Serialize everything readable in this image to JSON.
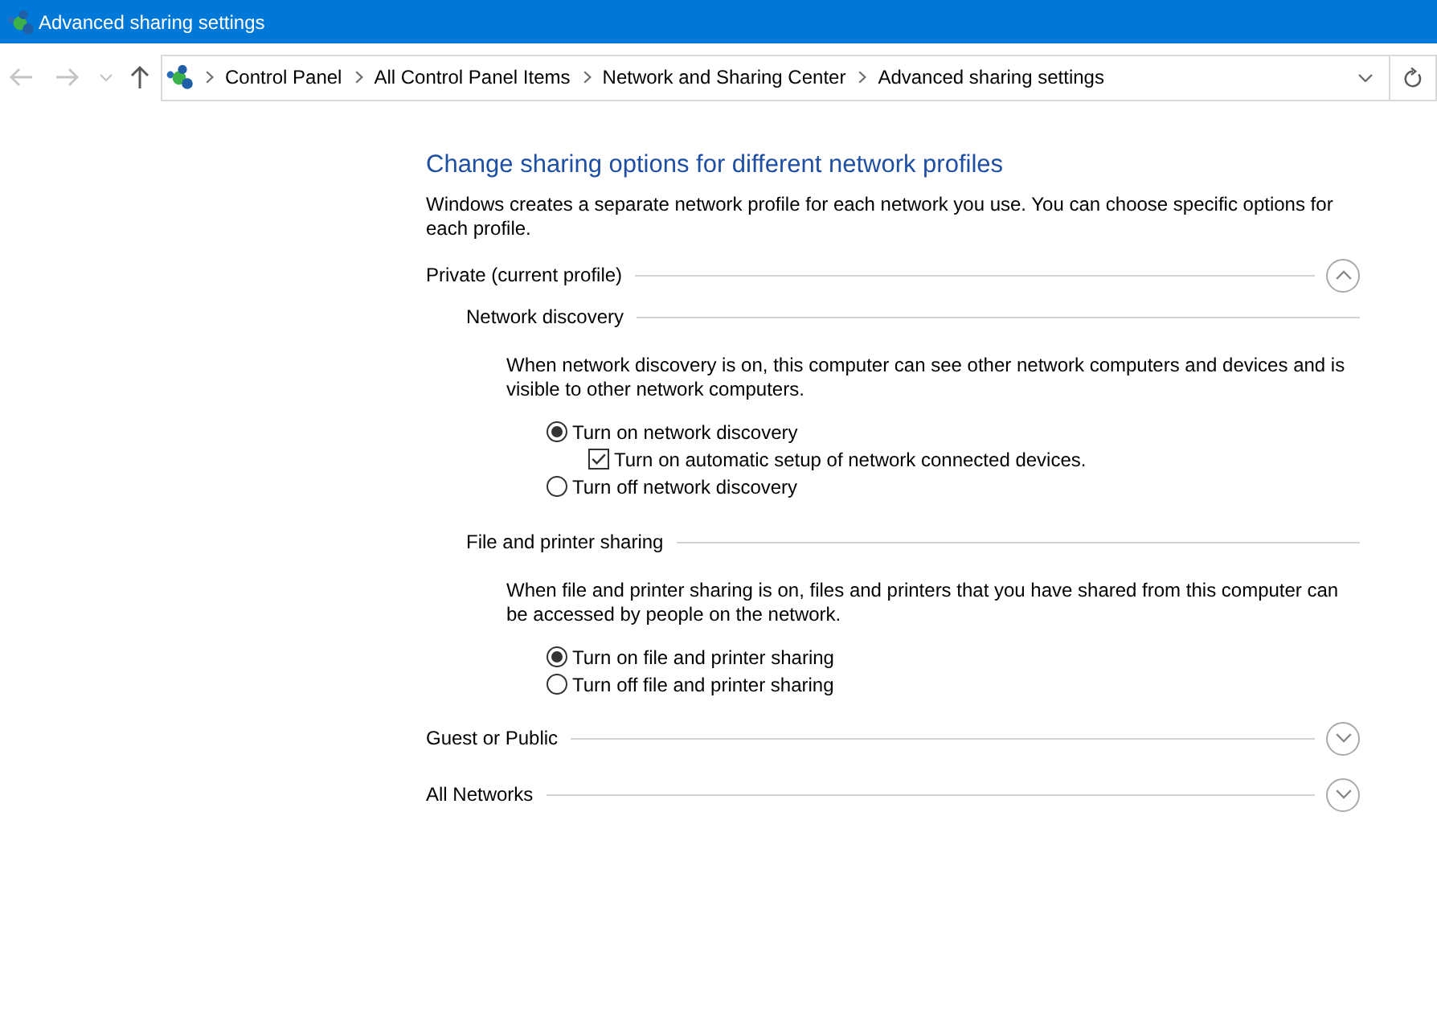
{
  "window": {
    "title": "Advanced sharing settings"
  },
  "nav_buttons": [
    {
      "kind": "back",
      "disabled": true
    },
    {
      "kind": "forward",
      "disabled": true
    },
    {
      "kind": "recent",
      "disabled": true
    },
    {
      "kind": "up",
      "disabled": false
    }
  ],
  "address_bar": {
    "breadcrumbs": [
      "Control Panel",
      "All Control Panel Items",
      "Network and Sharing Center",
      "Advanced sharing settings"
    ]
  },
  "page": {
    "heading": "Change sharing options for different network profiles",
    "description": "Windows creates a separate network profile for each network you use. You can choose specific options for each profile."
  },
  "profiles": [
    {
      "name": "Private (current profile)",
      "expanded": true,
      "sections": [
        {
          "title": "Network discovery",
          "description": "When network discovery is on, this computer can see other network computers and devices and is visible to other network computers.",
          "options": [
            {
              "kind": "radio",
              "label": "Turn on network discovery",
              "selected": true,
              "children": [
                {
                  "kind": "checkbox",
                  "label": "Turn on automatic setup of network connected devices.",
                  "checked": true
                }
              ]
            },
            {
              "kind": "radio",
              "label": "Turn off network discovery",
              "selected": false
            }
          ]
        },
        {
          "title": "File and printer sharing",
          "description": "When file and printer sharing is on, files and printers that you have shared from this computer can be accessed by people on the network.",
          "options": [
            {
              "kind": "radio",
              "label": "Turn on file and printer sharing",
              "selected": true
            },
            {
              "kind": "radio",
              "label": "Turn off file and printer sharing",
              "selected": false
            }
          ]
        }
      ]
    },
    {
      "name": "Guest or Public",
      "expanded": false
    },
    {
      "name": "All Networks",
      "expanded": false
    }
  ]
}
